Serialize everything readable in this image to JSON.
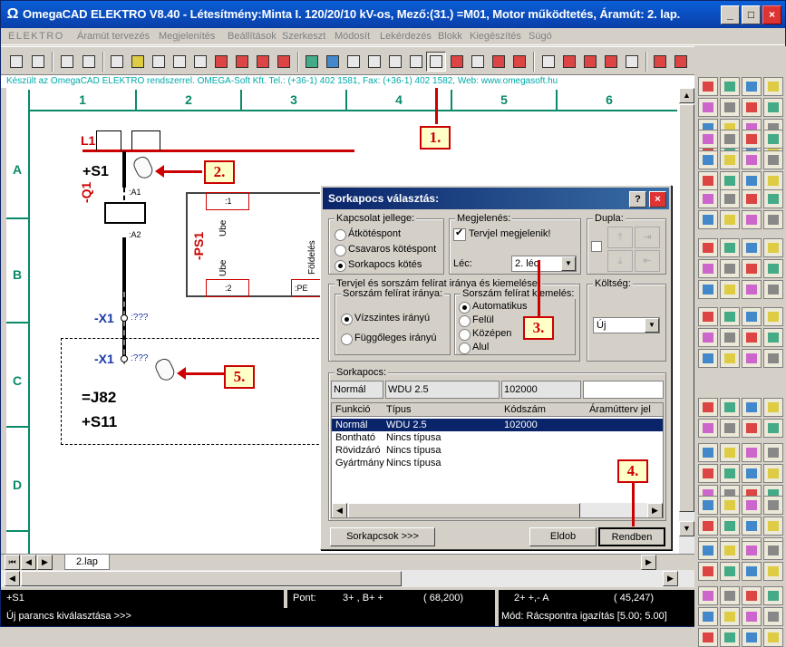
{
  "window": {
    "title": "OmegaCAD ELEKTRO V8.40 - Létesítmény:Minta I. 120/20/10 kV-os, Mező:(31.) =M01, Motor működtetés, Áramút:  2. lap.",
    "app_icon": "omega-icon",
    "controls": [
      "_",
      "□",
      "×"
    ]
  },
  "menu": [
    "ELEKTRO",
    "Áramút tervezés",
    "Megjelenítés",
    "Beállítások",
    "Szerkeszt",
    "Módosít",
    "Lekérdezés",
    "Blokk",
    "Kiegészítés",
    "Súgó"
  ],
  "infobar": "Készült az OmegaCAD ELEKTRO rendszerrel. OMEGA-Soft Kft. Tel.: (+36-1) 402 1581, Fax: (+36-1) 402 1582, Web: www.omegasoft.hu",
  "drawing": {
    "columns": [
      "1",
      "2",
      "3",
      "4",
      "5",
      "6"
    ],
    "rows": [
      "A",
      "B",
      "C",
      "D"
    ],
    "labels": {
      "l1": "L1",
      "s1": "+S1",
      "q1": "-Q1",
      "a1": ":A1",
      "a2": ":A2",
      "x1a": "-X1",
      "x1a_pin": ":???",
      "x1b": "-X1",
      "x1b_pin": ":???",
      "j82": "=J82",
      "s11": "+S11",
      "ps1": "-PS1",
      "ube1": "Ube",
      "ube2": "Ube",
      "foldeles": "Földelés",
      "pin1": ":1",
      "pin2": ":2",
      "pe": ":PE"
    }
  },
  "callouts": [
    "1.",
    "2.",
    "3.",
    "4.",
    "5."
  ],
  "dialog": {
    "title": "Sorkapocs választás:",
    "help_button": "?",
    "close_button": "×",
    "kapcsolat": {
      "label": "Kapcsolat jellege:",
      "options": [
        "Átkötéspont",
        "Csavaros kötéspont",
        "Sorkapocs kötés"
      ],
      "selected": 2
    },
    "megjelenes": {
      "label": "Megjelenés:",
      "checkbox": "Tervjel megjelenik!",
      "checked": true,
      "lec_label": "Léc:",
      "lec_value": "2. léc"
    },
    "dupla": {
      "label": "Dupla:"
    },
    "irany_group": {
      "label": "Tervjel és sorszám felírat iránya és kiemelése:",
      "sub1_label": "Sorszám felírat iránya:",
      "sub1_options": [
        "Vízszintes irányú",
        "Függőleges irányú"
      ],
      "sub1_selected": 0,
      "sub2_label": "Sorszám felírat kiemelés:",
      "sub2_options": [
        "Automatikus",
        "Felül",
        "Középen",
        "Alul"
      ],
      "sub2_selected": 0
    },
    "koltseg": {
      "label": "Költség:",
      "value": "Új"
    },
    "sorkapocs": {
      "label": "Sorkapocs:",
      "field1": "Normál",
      "field2": "WDU 2.5",
      "field3": "102000",
      "field4": "",
      "headers": [
        "Funkció",
        "Típus",
        "Kódszám",
        "Áramútterv jel"
      ],
      "rows": [
        [
          "Normál",
          "WDU 2.5",
          "102000",
          ""
        ],
        [
          "Bontható",
          "Nincs típusa",
          "",
          ""
        ],
        [
          "Rövidzáró",
          "Nincs típusa",
          "",
          ""
        ],
        [
          "Gyártmány",
          "Nincs típusa",
          "",
          ""
        ]
      ],
      "selected_row": 0
    },
    "buttons": {
      "sorkapcsok": "Sorkapcsok >>>",
      "eldob": "Eldob",
      "rendben": "Rendben"
    }
  },
  "tabs": {
    "active": "2.lap"
  },
  "status": {
    "object": "+S1",
    "pont_label": "Pont:",
    "pont_value": "3+ ,  B+ +",
    "pont_coord": "( 68,200)",
    "pos_label": "2+ +,- A",
    "pos_coord": "( 45,247)",
    "command": "Új parancs kiválasztása >>>",
    "mode": "Mód: Rácspontra igazítás  [5.00; 5.00]"
  },
  "colors": {
    "titlebar": "#0a3ea8",
    "grid": "#0a8a6a",
    "callout_border": "#cc0000",
    "callout_bg": "#ffffc8",
    "selection": "#0a246a"
  }
}
